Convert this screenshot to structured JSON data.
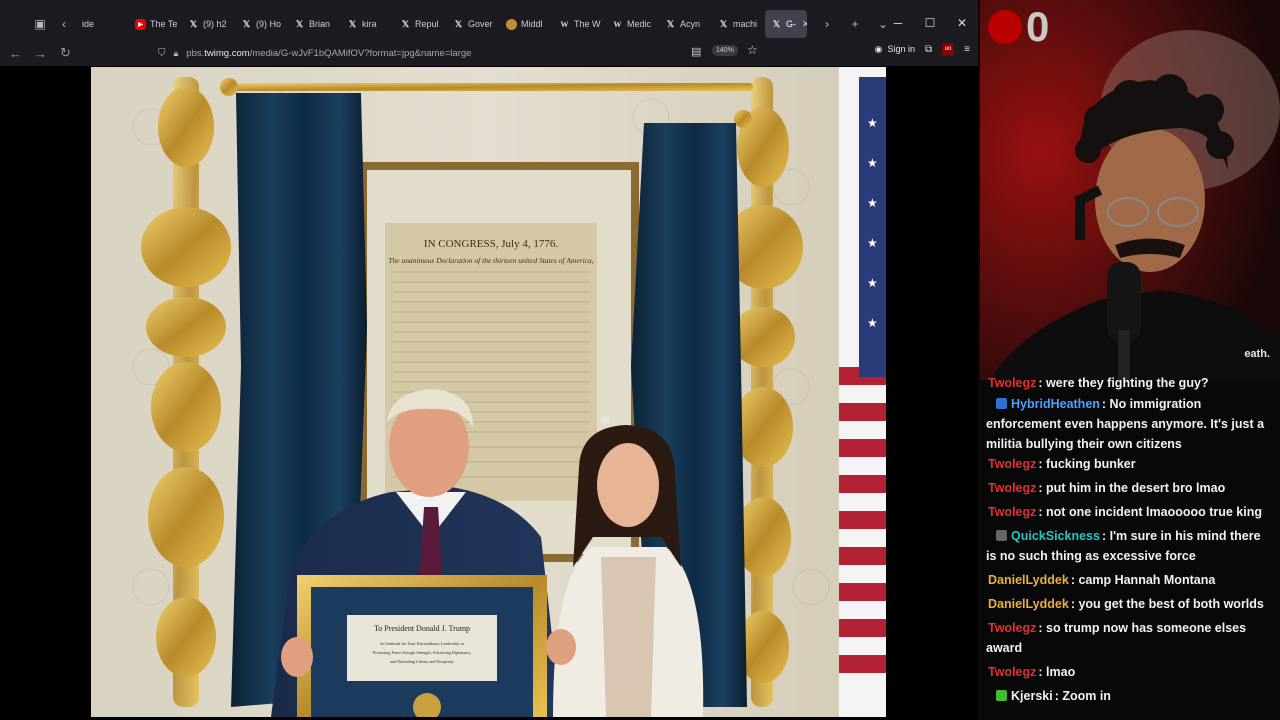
{
  "browser": {
    "tabs": [
      {
        "label": "ide",
        "icon": "none"
      },
      {
        "label": "The Te",
        "icon": "youtube"
      },
      {
        "label": "(9) h2",
        "icon": "x"
      },
      {
        "label": "(9) Ho",
        "icon": "x"
      },
      {
        "label": "Brian",
        "icon": "x"
      },
      {
        "label": "kira",
        "icon": "x"
      },
      {
        "label": "Repul",
        "icon": "x"
      },
      {
        "label": "Gover",
        "icon": "x"
      },
      {
        "label": "Middl",
        "icon": "circle"
      },
      {
        "label": "The W",
        "icon": "wikipedia"
      },
      {
        "label": "Medic",
        "icon": "wikipedia"
      },
      {
        "label": "Acyn",
        "icon": "x"
      },
      {
        "label": "machi",
        "icon": "x"
      }
    ],
    "active_tab": {
      "label": "G-",
      "icon": "x"
    },
    "url_prefix": "pbs.",
    "url_domain": "twimg.com",
    "url_path": "/media/G-wJvF1bQAMifOV?format=jpg&name=large",
    "zoom": "140%",
    "sign_in": "Sign in",
    "ext_badge": "uo"
  },
  "photo": {
    "document_heading": "IN CONGRESS, July 4, 1776.",
    "document_subheading": "The unanimous Declaration of the thirteen united States of America,",
    "plaque_title": "To President Donald J. Trump",
    "plaque_text_1": "In Gratitude for Your Extraordinary Leadership in",
    "plaque_text_2": "Promoting Peace through Strength, Advancing Diplomacy,",
    "plaque_text_3": "and Defending Liberty and Prosperity"
  },
  "webcam": {
    "overlay_number": "0",
    "overlay_tag": "eath."
  },
  "chat": {
    "messages": [
      {
        "user": "Twolegz",
        "text": "were they fighting the guy?",
        "color": "#e03030",
        "badge": "none"
      },
      {
        "user": "HybridHeathen",
        "text": "No immigration enforcement even happens anymore. It's just a militia bullying their own citizens",
        "color": "#4aa0ff",
        "badge": "blue"
      },
      {
        "user": "Twolegz",
        "text": "fucking bunker",
        "color": "#e03030",
        "badge": "none"
      },
      {
        "user": "Twolegz",
        "text": "put him in the desert bro lmao",
        "color": "#e03030",
        "badge": "none"
      },
      {
        "user": "Twolegz",
        "text": "not one incident lmaooooo true king",
        "color": "#e03030",
        "badge": "none"
      },
      {
        "user": "QuickSickness",
        "text": "I'm sure in his mind there is no such thing as excessive force",
        "color": "#20c8c0",
        "badge": "gray"
      },
      {
        "user": "DanielLyddek",
        "text": "camp Hannah Montana",
        "color": "#e8b040",
        "badge": "none"
      },
      {
        "user": "DanielLyddek",
        "text": "you get the best of both worlds",
        "color": "#e8b040",
        "badge": "none"
      },
      {
        "user": "Twolegz",
        "text": "so trump now has someone elses award",
        "color": "#e03030",
        "badge": "none"
      },
      {
        "user": "Twolegz",
        "text": "lmao",
        "color": "#e03030",
        "badge": "none"
      },
      {
        "user": "Kjerski",
        "text": "Zoom in",
        "color": "#f0f0f0",
        "badge": "green"
      }
    ]
  }
}
